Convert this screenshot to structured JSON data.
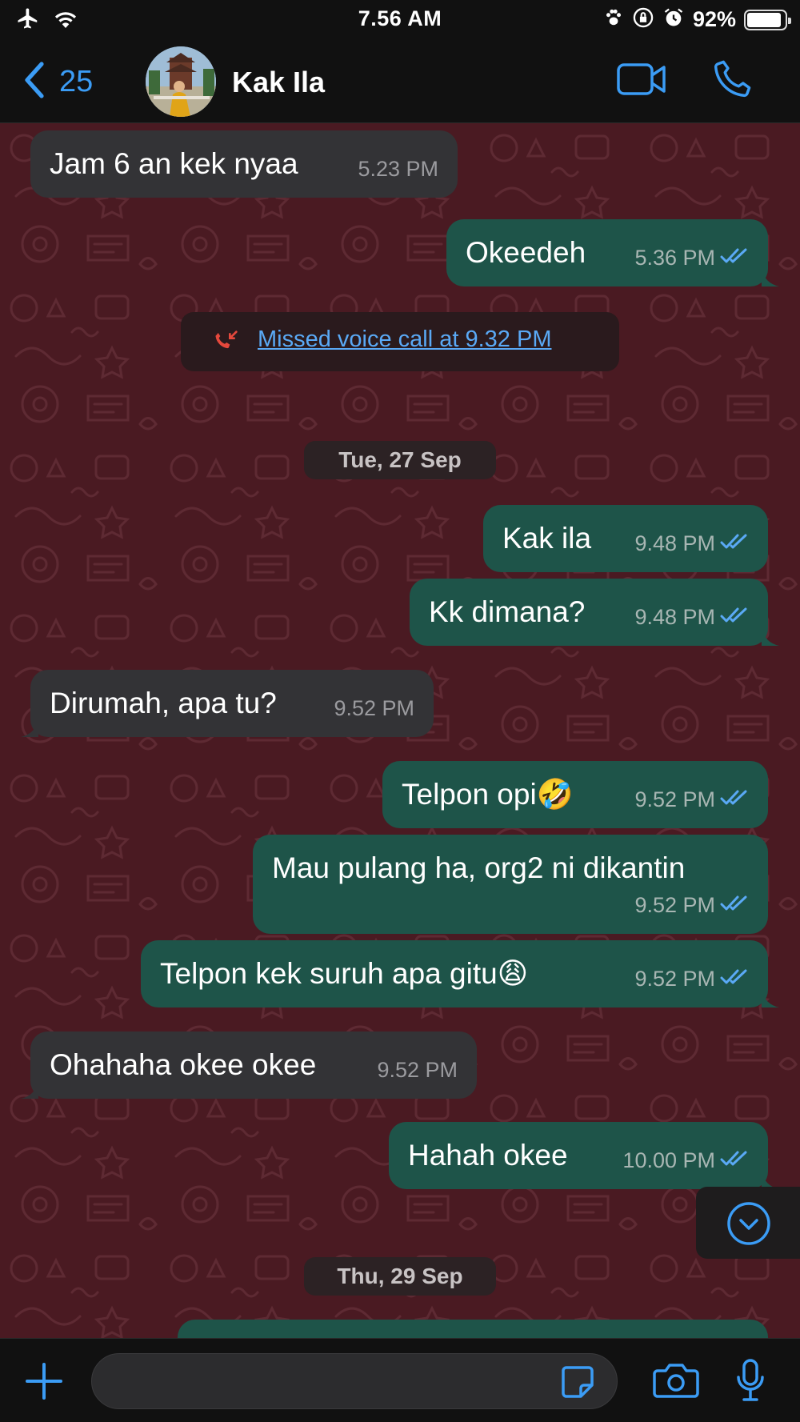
{
  "status_bar": {
    "time": "7.56 AM",
    "battery_percent": "92%",
    "battery_level": 0.92,
    "icons": [
      "airplane-icon",
      "wifi-icon",
      "paw-icon",
      "lock-rotation-icon",
      "alarm-icon",
      "battery-icon"
    ]
  },
  "header": {
    "back_count": "25",
    "contact_name": "Kak Ila",
    "icons": [
      "chevron-left-icon",
      "video-call-icon",
      "phone-icon"
    ]
  },
  "messages": [
    {
      "side": "in",
      "text": "Jam 6 an kek nyaa",
      "time": "5.23 PM"
    },
    {
      "side": "out",
      "text": "Okeedeh",
      "time": "5.36 PM"
    },
    {
      "side": "out",
      "text": "Kak ila",
      "time": "9.48 PM"
    },
    {
      "side": "out",
      "text": "Kk dimana?",
      "time": "9.48 PM"
    },
    {
      "side": "in",
      "text": "Dirumah, apa tu?",
      "time": "9.52 PM"
    },
    {
      "side": "out",
      "text": "Telpon opi🤣",
      "time": "9.52 PM"
    },
    {
      "side": "out",
      "text": "Mau pulang ha, org2 ni dikantin",
      "time": "9.52 PM"
    },
    {
      "side": "out",
      "text": "Telpon kek suruh apa gitu😩",
      "time": "9.52 PM"
    },
    {
      "side": "in",
      "text": "Ohahaha okee okee",
      "time": "9.52 PM"
    },
    {
      "side": "out",
      "text": "Hahah okee",
      "time": "10.00 PM"
    }
  ],
  "missed_call": {
    "text": "Missed voice call at 9.32 PM"
  },
  "dates": [
    "Tue, 27 Sep",
    "Thu, 29 Sep"
  ],
  "input_bar": {
    "placeholder": "",
    "icons": [
      "plus-icon",
      "sticker-icon",
      "camera-icon",
      "microphone-icon"
    ]
  },
  "colors": {
    "accent": "#3b9cf5",
    "chat_background": "#4a1a22",
    "incoming_bubble": "#333336",
    "outgoing_bubble": "#1e5449",
    "read_ticks": "#5aa9f5",
    "missed_call_icon": "#e5483c"
  }
}
